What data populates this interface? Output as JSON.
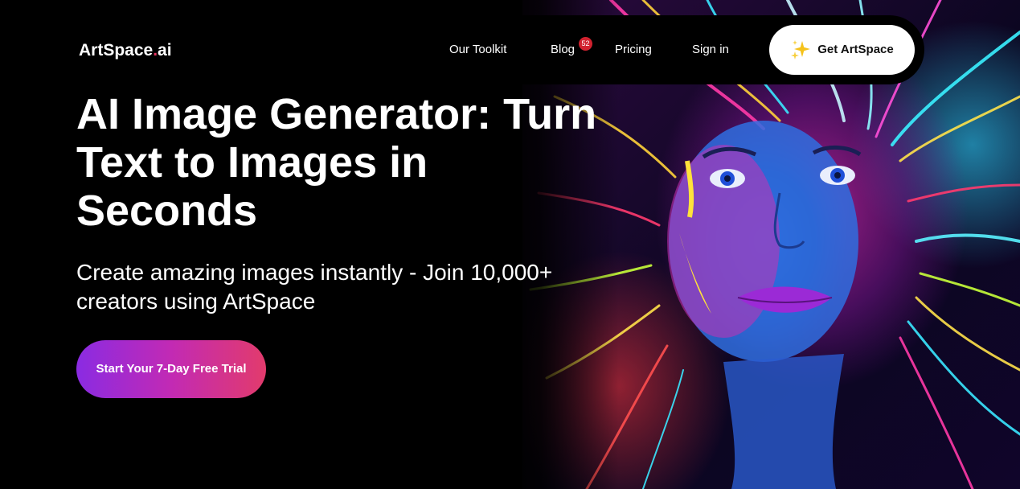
{
  "brand": {
    "name_main": "ArtSpace",
    "name_dot": ".",
    "name_suffix": "ai",
    "accent_color": "#e8335f"
  },
  "nav": {
    "items": [
      {
        "label": "Our Toolkit"
      },
      {
        "label": "Blog",
        "badge": "52"
      },
      {
        "label": "Pricing"
      },
      {
        "label": "Sign in"
      }
    ],
    "cta": {
      "label": "Get ArtSpace",
      "icon": "sparkles-icon"
    }
  },
  "hero": {
    "title": "AI Image Generator: Turn Text to Images in Seconds",
    "subtitle": "Create amazing images instantly - Join 10,000+ creators using ArtSpace",
    "cta_label": "Start Your 7-Day Free Trial",
    "cta_gradient": [
      "#8a2be2",
      "#e23b6c"
    ],
    "image": "neon-portrait-illustration"
  }
}
